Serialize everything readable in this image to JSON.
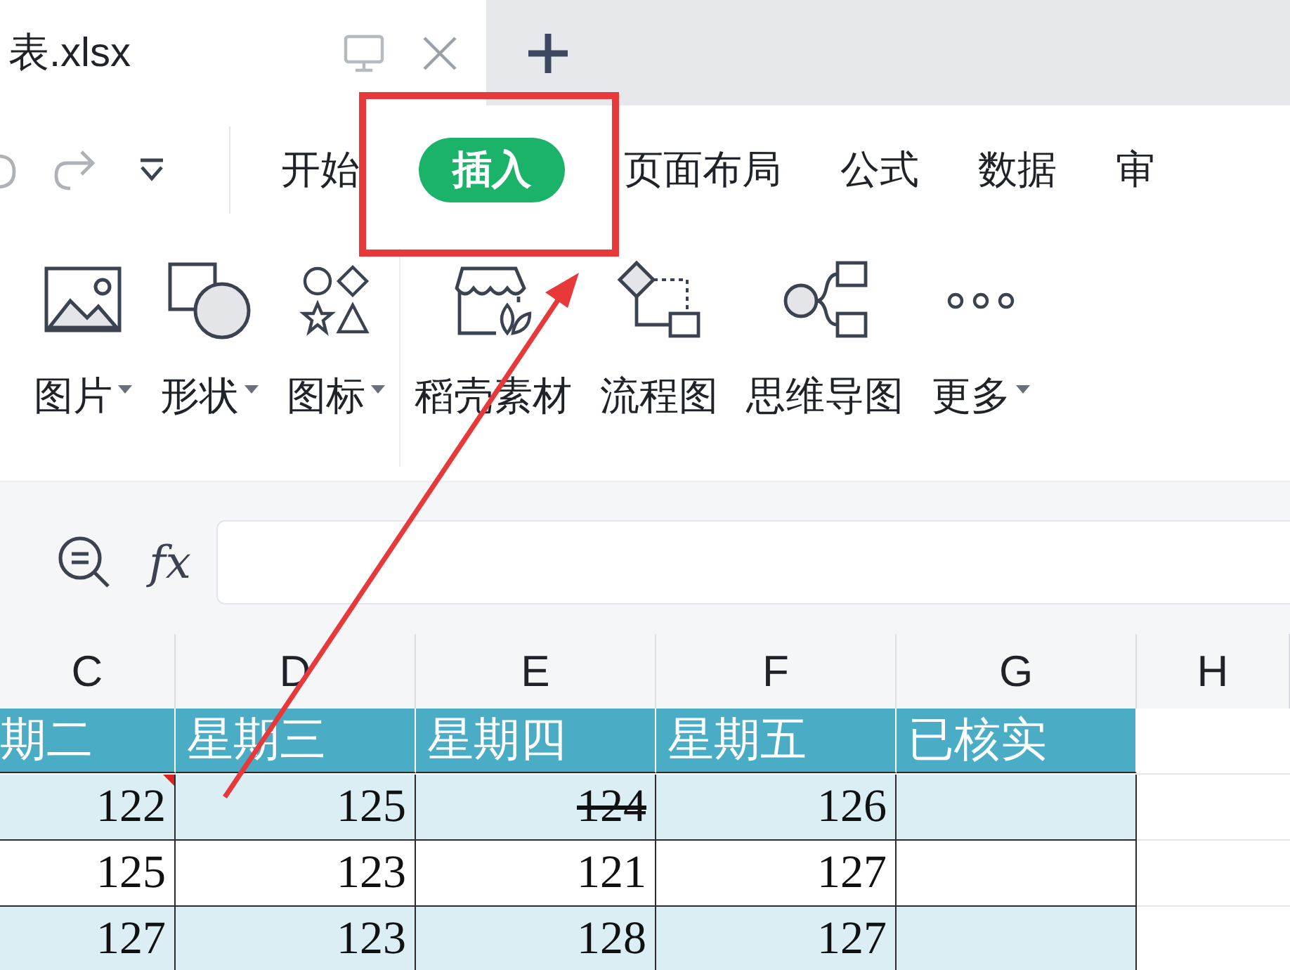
{
  "document_tab": {
    "title": "表.xlsx"
  },
  "menu_tabs": [
    {
      "label": "开始",
      "selected": false
    },
    {
      "label": "插入",
      "selected": true
    },
    {
      "label": "页面布局",
      "selected": false
    },
    {
      "label": "公式",
      "selected": false
    },
    {
      "label": "数据",
      "selected": false
    },
    {
      "label": "审",
      "selected": false
    }
  ],
  "ribbon": [
    {
      "kind": "picture",
      "label": "图片",
      "dropdown": true
    },
    {
      "kind": "shape",
      "label": "形状",
      "dropdown": true
    },
    {
      "kind": "iconset",
      "label": "图标",
      "dropdown": true
    },
    {
      "kind": "material",
      "label": "稻壳素材",
      "dropdown": false
    },
    {
      "kind": "flowchart",
      "label": "流程图",
      "dropdown": false
    },
    {
      "kind": "mindmap",
      "label": "思维导图",
      "dropdown": false
    },
    {
      "kind": "more",
      "label": "更多",
      "dropdown": true
    }
  ],
  "formula_bar": {
    "fx": "fx"
  },
  "columns": [
    "C",
    "D",
    "E",
    "F",
    "G",
    "H"
  ],
  "header_row": [
    "期二",
    "星期三",
    "星期四",
    "星期五",
    "已核实"
  ],
  "rows": [
    {
      "cells": [
        {
          "text": "122",
          "struck": false,
          "comment": true
        },
        {
          "text": "125",
          "struck": false,
          "comment": false
        },
        {
          "text": "124",
          "struck": true,
          "comment": false
        },
        {
          "text": "126",
          "struck": false,
          "comment": false
        }
      ]
    },
    {
      "cells": [
        {
          "text": "125",
          "struck": false,
          "comment": false
        },
        {
          "text": "123",
          "struck": false,
          "comment": false
        },
        {
          "text": "121",
          "struck": false,
          "comment": false
        },
        {
          "text": "127",
          "struck": false,
          "comment": false
        }
      ]
    },
    {
      "cells": [
        {
          "text": "127",
          "struck": false,
          "comment": false
        },
        {
          "text": "123",
          "struck": false,
          "comment": false
        },
        {
          "text": "128",
          "struck": false,
          "comment": false
        },
        {
          "text": "127",
          "struck": false,
          "comment": false
        }
      ]
    }
  ]
}
